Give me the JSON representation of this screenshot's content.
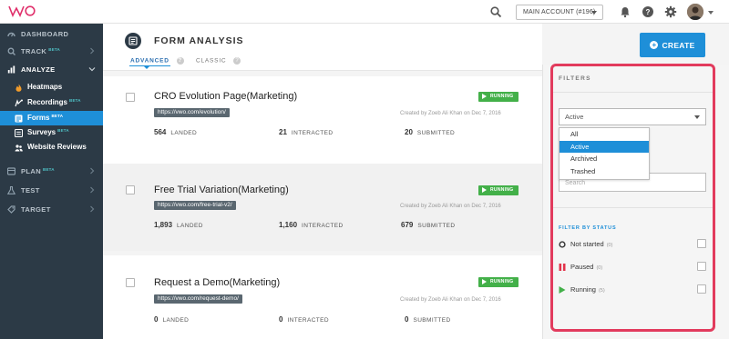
{
  "topbar": {
    "account": "MAIN ACCOUNT (#196)",
    "icons": [
      "search-icon",
      "bell-icon",
      "help-icon",
      "gear-icon",
      "avatar"
    ]
  },
  "sidebar": {
    "items": [
      {
        "label": "DASHBOARD",
        "icon": "dashboard-icon"
      },
      {
        "label": "TRACK",
        "beta": "BETA",
        "icon": "track-icon"
      },
      {
        "label": "ANALYZE",
        "icon": "analyze-icon"
      },
      {
        "label": "PLAN",
        "beta": "BETA",
        "icon": "plan-icon"
      },
      {
        "label": "TEST",
        "icon": "test-icon"
      },
      {
        "label": "TARGET",
        "icon": "target-icon"
      }
    ],
    "analyze_sub": [
      {
        "label": "Heatmaps",
        "icon": "flame-icon"
      },
      {
        "label": "Recordings",
        "beta": "BETA",
        "icon": "recordings-icon"
      },
      {
        "label": "Forms",
        "beta": "BETA",
        "icon": "forms-icon",
        "active": true
      },
      {
        "label": "Surveys",
        "beta": "BETA",
        "icon": "surveys-icon"
      },
      {
        "label": "Website Reviews",
        "icon": "reviews-icon"
      }
    ]
  },
  "header": {
    "title": "FORM ANALYSIS",
    "tabs": [
      {
        "label": "ADVANCED",
        "help": "?",
        "active": true
      },
      {
        "label": "CLASSIC",
        "help": "?"
      }
    ],
    "create_label": "CREATE",
    "create_plus": "+"
  },
  "cards": [
    {
      "title": "CRO Evolution Page(Marketing)",
      "url": "https://vwo.com/evolution/",
      "status": "RUNNING",
      "created": "Created by Zoeb Ali Khan on Dec 7, 2016",
      "landed": "564",
      "landed_label": "LANDED",
      "interacted": "21",
      "interacted_label": "INTERACTED",
      "submitted": "20",
      "submitted_label": "SUBMITTED"
    },
    {
      "title": "Free Trial Variation(Marketing)",
      "url": "https://vwo.com/free-trial-v2/",
      "status": "RUNNING",
      "created": "Created by Zoeb Ali Khan on Dec 7, 2016",
      "landed": "1,893",
      "landed_label": "LANDED",
      "interacted": "1,160",
      "interacted_label": "INTERACTED",
      "submitted": "679",
      "submitted_label": "SUBMITTED"
    },
    {
      "title": "Request a Demo(Marketing)",
      "url": "https://vwo.com/request-demo/",
      "status": "RUNNING",
      "created": "Created by Zoeb Ali Khan on Dec 7, 2016",
      "landed": "0",
      "landed_label": "LANDED",
      "interacted": "0",
      "interacted_label": "INTERACTED",
      "submitted": "0",
      "submitted_label": "SUBMITTED"
    }
  ],
  "filters": {
    "title": "FILTERS",
    "selected": "Active",
    "options": [
      "All",
      "Active",
      "Archived",
      "Trashed"
    ],
    "search_placeholder": "Search",
    "status_title": "FILTER BY STATUS",
    "statuses": [
      {
        "label": "Not started",
        "count": "(0)",
        "icon": "circle-icon"
      },
      {
        "label": "Paused",
        "count": "(0)",
        "icon": "pause-icon"
      },
      {
        "label": "Running",
        "count": "(5)",
        "icon": "play-icon"
      }
    ]
  },
  "colors": {
    "sidebar_bg": "#2c3a46",
    "accent": "#1e8fd8",
    "running": "#43b049",
    "highlight_outline": "#e23b5d"
  }
}
